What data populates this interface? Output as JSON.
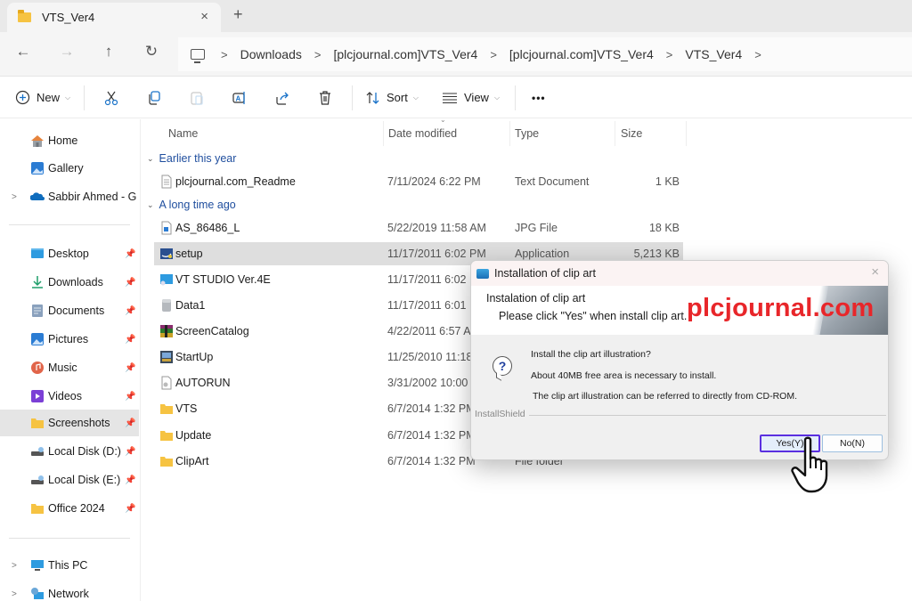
{
  "tab": {
    "title": "VTS_Ver4",
    "close_label": "×",
    "new_tab_label": "+"
  },
  "nav": {
    "back": "←",
    "forward": "→",
    "up": "↑",
    "refresh": "↻"
  },
  "breadcrumb": [
    "Downloads",
    "[plcjournal.com]VTS_Ver4",
    "[plcjournal.com]VTS_Ver4",
    "VTS_Ver4"
  ],
  "toolbar": {
    "new_label": "New",
    "sort_label": "Sort",
    "view_label": "View",
    "more_label": "•••",
    "icons": [
      "cut-icon",
      "copy-icon",
      "paste-icon",
      "rename-icon",
      "share-icon",
      "delete-icon"
    ]
  },
  "sidebar": {
    "top_items": [
      {
        "label": "Home",
        "icon": "home-icon"
      },
      {
        "label": "Gallery",
        "icon": "gallery-icon"
      },
      {
        "label": "Sabbir Ahmed - Glo",
        "icon": "onedrive-icon",
        "expandable": true
      }
    ],
    "quick_access": [
      {
        "label": "Desktop",
        "icon": "desktop-icon",
        "pinned": true
      },
      {
        "label": "Downloads",
        "icon": "downloads-icon",
        "pinned": true
      },
      {
        "label": "Documents",
        "icon": "documents-icon",
        "pinned": true
      },
      {
        "label": "Pictures",
        "icon": "pictures-icon",
        "pinned": true
      },
      {
        "label": "Music",
        "icon": "music-icon",
        "pinned": true
      },
      {
        "label": "Videos",
        "icon": "videos-icon",
        "pinned": true
      },
      {
        "label": "Screenshots",
        "icon": "folder-icon",
        "pinned": true,
        "selected": true
      },
      {
        "label": "Local Disk (D:)",
        "icon": "drive-icon",
        "pinned": true
      },
      {
        "label": "Local Disk (E:)",
        "icon": "drive-icon",
        "pinned": true
      },
      {
        "label": "Office 2024",
        "icon": "folder-icon",
        "pinned": true
      }
    ],
    "bottom_items": [
      {
        "label": "This PC",
        "icon": "this-pc-icon",
        "expandable": true
      },
      {
        "label": "Network",
        "icon": "network-icon",
        "expandable": true
      }
    ]
  },
  "columns": {
    "name": "Name",
    "date": "Date modified",
    "type": "Type",
    "size": "Size"
  },
  "groups": [
    {
      "label": "Earlier this year",
      "files": [
        {
          "name": "plcjournal.com_Readme",
          "date": "7/11/2024 6:22 PM",
          "type": "Text Document",
          "size": "1 KB",
          "icon": "text-file-icon"
        }
      ]
    },
    {
      "label": "A long time ago",
      "files": [
        {
          "name": "AS_86486_L",
          "date": "5/22/2019 11:58 AM",
          "type": "JPG File",
          "size": "18 KB",
          "icon": "image-file-icon"
        },
        {
          "name": "setup",
          "date": "11/17/2011 6:02 PM",
          "type": "Application",
          "size": "5,213 KB",
          "icon": "setup-icon",
          "selected": true
        },
        {
          "name": "VT STUDIO Ver.4E",
          "date": "11/17/2011 6:02 PM",
          "type": "",
          "size": "",
          "icon": "vtstudio-icon"
        },
        {
          "name": "Data1",
          "date": "11/17/2011 6:01 PM",
          "type": "",
          "size": "",
          "icon": "cabinet-icon"
        },
        {
          "name": "ScreenCatalog",
          "date": "4/22/2011 6:57 AM",
          "type": "",
          "size": "",
          "icon": "archive-icon"
        },
        {
          "name": "StartUp",
          "date": "11/25/2010 11:18",
          "type": "",
          "size": "",
          "icon": "startup-icon"
        },
        {
          "name": "AUTORUN",
          "date": "3/31/2002 10:00 PM",
          "type": "",
          "size": "",
          "icon": "autorun-icon"
        },
        {
          "name": "VTS",
          "date": "6/7/2014 1:32 PM",
          "type": "",
          "size": "",
          "icon": "folder-icon"
        },
        {
          "name": "Update",
          "date": "6/7/2014 1:32 PM",
          "type": "",
          "size": "",
          "icon": "folder-icon"
        },
        {
          "name": "ClipArt",
          "date": "6/7/2014 1:32 PM",
          "type": "File folder",
          "size": "",
          "icon": "folder-icon"
        }
      ]
    }
  ],
  "dialog": {
    "title": "Installation of clip art",
    "close_label": "×",
    "banner_heading": "Instalation of clip art",
    "banner_subheading": "Please click \"Yes\" when install clip art.",
    "watermark": "plcjournal.com",
    "messages": [
      "Install the clip art illustration?",
      "About 40MB free area is necessary to install.",
      "The clip art illustration can be referred to directly from CD-ROM."
    ],
    "footer_label": "InstallShield",
    "yes_label": "Yes(Y)",
    "no_label": "No(N)"
  },
  "colors": {
    "accent_selection": "#5a2fe0",
    "watermark": "#e8262a",
    "group_header": "#1f4e9e",
    "folder": "#f6c342"
  }
}
